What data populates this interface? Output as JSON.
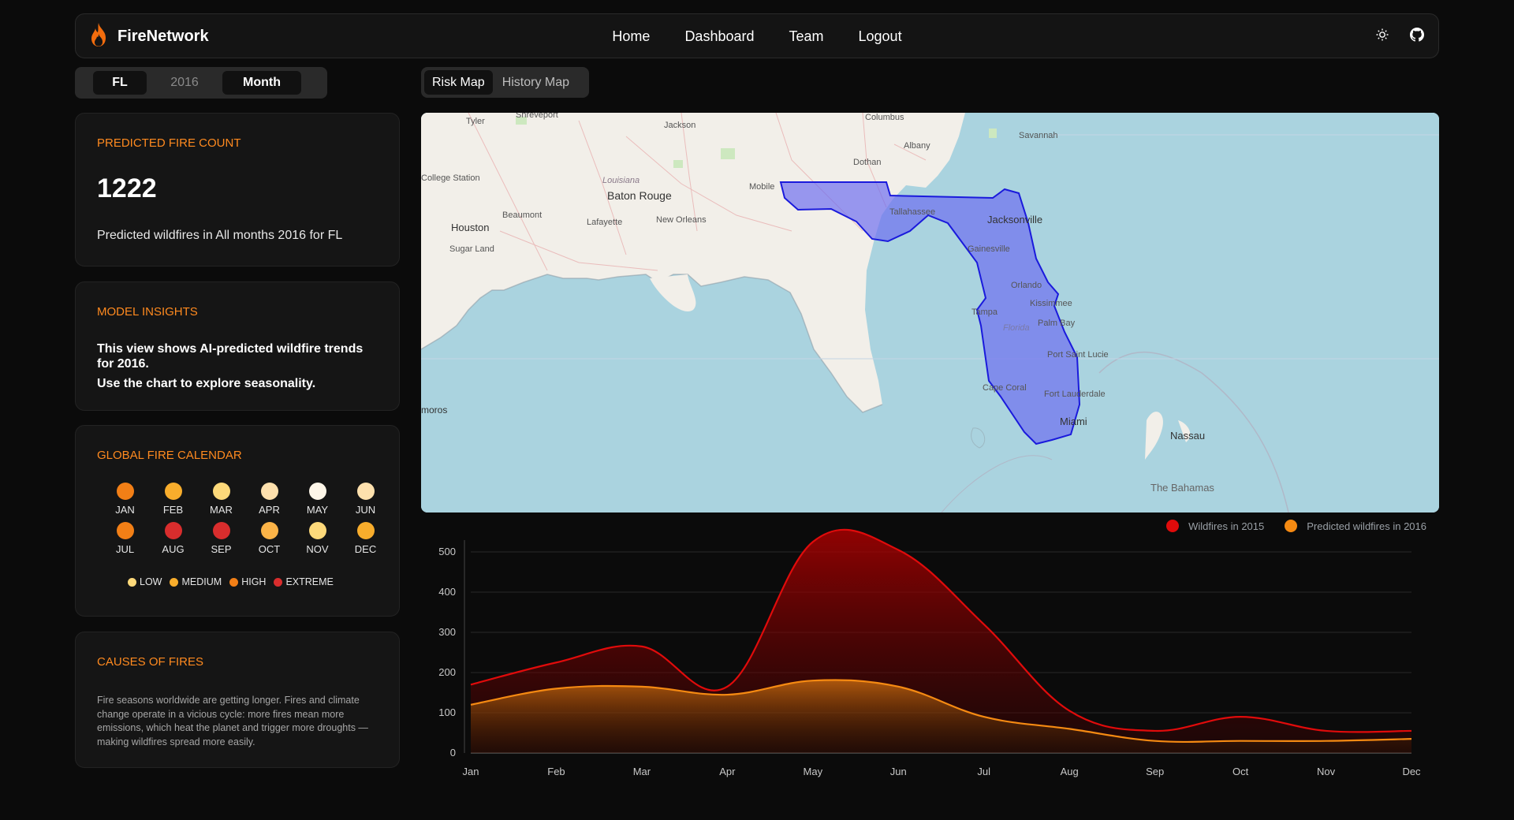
{
  "header": {
    "brand": "FireNetwork",
    "nav": [
      "Home",
      "Dashboard",
      "Team",
      "Logout"
    ],
    "icons": [
      "sun-icon",
      "github-icon"
    ]
  },
  "selector": {
    "state": "FL",
    "year": "2016",
    "mode": "Month"
  },
  "map_tabs": {
    "active": "Risk Map",
    "inactive": "History Map"
  },
  "cards": {
    "predicted": {
      "title": "PREDICTED FIRE COUNT",
      "value": "1222",
      "subtitle": "Predicted wildfires in All months 2016 for FL"
    },
    "insights": {
      "title": "MODEL INSIGHTS",
      "line1": "This view shows AI-predicted wildfire trends for 2016.",
      "line2": "Use the chart to explore seasonality."
    },
    "calendar": {
      "title": "GLOBAL FIRE CALENDAR",
      "months": [
        {
          "label": "JAN",
          "level": "high"
        },
        {
          "label": "FEB",
          "level": "medium"
        },
        {
          "label": "MAR",
          "level": "low"
        },
        {
          "label": "APR",
          "level": "low-pale"
        },
        {
          "label": "MAY",
          "level": "minimal"
        },
        {
          "label": "JUN",
          "level": "low-pale"
        },
        {
          "label": "JUL",
          "level": "high"
        },
        {
          "label": "AUG",
          "level": "extreme"
        },
        {
          "label": "SEP",
          "level": "extreme"
        },
        {
          "label": "OCT",
          "level": "medium-light"
        },
        {
          "label": "NOV",
          "level": "low"
        },
        {
          "label": "DEC",
          "level": "medium"
        }
      ],
      "level_colors": {
        "minimal": "#fdf6e8",
        "low-pale": "#fde0ad",
        "low": "#fdd97a",
        "medium-light": "#fbb347",
        "medium": "#f8ad2c",
        "high": "#f27f16",
        "extreme": "#d92d2d"
      },
      "legend": [
        {
          "label": "LOW",
          "color": "#fdd97a"
        },
        {
          "label": "MEDIUM",
          "color": "#f8ad2c"
        },
        {
          "label": "HIGH",
          "color": "#f27f16"
        },
        {
          "label": "EXTREME",
          "color": "#d92d2d"
        }
      ]
    },
    "causes": {
      "title": "CAUSES OF FIRES",
      "text": "Fire seasons worldwide are getting longer. Fires and climate change operate in a vicious cycle: more fires mean more emissions, which heat the planet and trigger more droughts — making wildfires spread more easily."
    }
  },
  "map": {
    "labels": {
      "tyler": "Tyler",
      "shreveport": "Shreveport",
      "jackson": "Jackson",
      "columbus": "Columbus",
      "albany": "Albany",
      "savannah": "Savannah",
      "dothan": "Dothan",
      "college_station": "College Station",
      "louisiana": "Louisiana",
      "baton_rouge": "Baton Rouge",
      "mobile": "Mobile",
      "tallahassee": "Tallahassee",
      "jacksonville": "Jacksonville",
      "beaumont": "Beaumont",
      "lafayette": "Lafayette",
      "new_orleans": "New Orleans",
      "houston": "Houston",
      "sugar_land": "Sugar Land",
      "gainesville": "Gainesville",
      "orlando": "Orlando",
      "kissimmee": "Kissimmee",
      "tampa": "Tampa",
      "florida": "Florida",
      "palm_bay": "Palm Bay",
      "port_st_lucie": "Port Saint Lucie",
      "cape_coral": "Cape Coral",
      "fort_lauderdale": "Fort Lauderdale",
      "miami": "Miami",
      "nassau": "Nassau",
      "bahamas": "The Bahamas",
      "matamoros": "moros"
    },
    "colors": {
      "water": "#aad3df",
      "land": "#f2efe9",
      "highlight": "#6b6bf0",
      "highlight_stroke": "#1a1adc"
    }
  },
  "chart_data": {
    "type": "area",
    "categories": [
      "Jan",
      "Feb",
      "Mar",
      "Apr",
      "May",
      "Jun",
      "Jul",
      "Aug",
      "Sep",
      "Oct",
      "Nov",
      "Dec"
    ],
    "series": [
      {
        "name": "Wildfires in 2015",
        "color": "#e00b0b",
        "values": [
          170,
          225,
          265,
          165,
          525,
          505,
          320,
          105,
          55,
          90,
          55,
          55
        ]
      },
      {
        "name": "Predicted wildfires in 2016",
        "color": "#f58a12",
        "values": [
          120,
          160,
          165,
          145,
          180,
          165,
          90,
          60,
          30,
          30,
          30,
          35
        ]
      }
    ],
    "ylim": [
      0,
      500
    ],
    "yticks": [
      0,
      100,
      200,
      300,
      400,
      500
    ],
    "grid": true,
    "legend": "top-right"
  }
}
